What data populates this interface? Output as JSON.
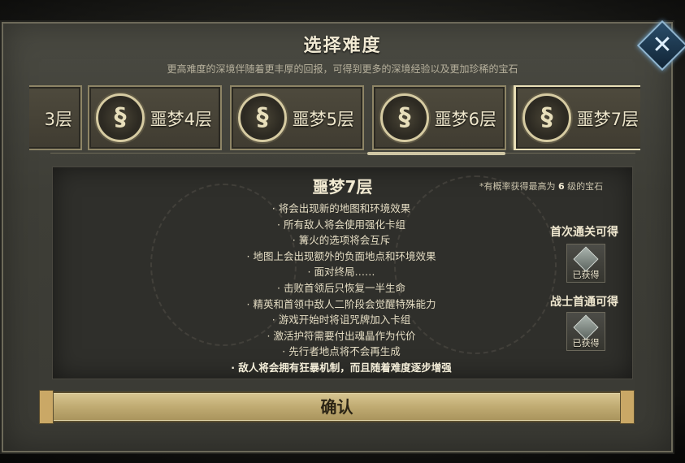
{
  "dialog": {
    "title": "选择难度",
    "subtitle": "更高难度的深境伴随着更丰厚的回报，可得到更多的深境经验以及更加珍稀的宝石"
  },
  "difficulty_cards": [
    {
      "label": "3层",
      "selected": false
    },
    {
      "label": "噩梦4层",
      "selected": false
    },
    {
      "label": "噩梦5层",
      "selected": false
    },
    {
      "label": "噩梦6层",
      "selected": false
    },
    {
      "label": "噩梦7层",
      "selected": true
    }
  ],
  "detail": {
    "floor_title": "噩梦7层",
    "hint_prefix": "*有概率获得最高为",
    "hint_level": "6",
    "hint_suffix": "级的宝石",
    "effects": [
      "· 将会出现新的地图和环境效果",
      "· 所有敌人将会使用强化卡组",
      "· 篝火的选项将会互斥",
      "· 地图上会出现额外的负面地点和环境效果",
      "· 面对终局……",
      "· 击败首领后只恢复一半生命",
      "· 精英和首领中敌人二阶段会觉醒特殊能力",
      "· 游戏开始时将诅咒牌加入卡组",
      "· 激活护符需要付出魂晶作为代价",
      "· 先行者地点将不会再生成",
      "· 敌人将会拥有狂暴机制，而且随着难度逐步增强"
    ],
    "rewards": [
      {
        "title": "首次通关可得",
        "status": "已获得"
      },
      {
        "title": "战士首通可得",
        "status": "已获得"
      }
    ]
  },
  "confirm_label": "确认",
  "colors": {
    "accent_gold": "#c2ad74",
    "panel": "#3e3e37",
    "close_blue": "#2a4d6a"
  }
}
